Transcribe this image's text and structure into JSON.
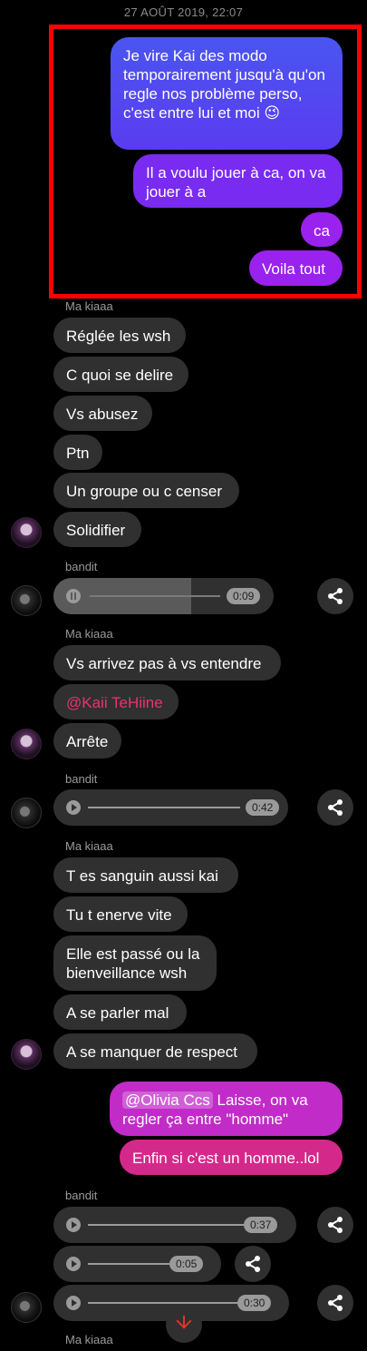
{
  "timestamp": "27 AOÛT 2019, 22:07",
  "sent_block_1": [
    "Je vire Kai des modo temporairement jusqu'à qu'on regle nos problème perso, c'est entre lui et moi 😉",
    "Il a voulu jouer à ca, on va jouer à a",
    "ca",
    "Voila tout"
  ],
  "senders": {
    "kiaaa": "Ma kiaaa",
    "bandit": "bandit"
  },
  "recv_block_1": [
    "Réglée les wsh",
    "C quoi se delire",
    "Vs abusez",
    "Ptn",
    "Un groupe ou c censer",
    "Solidifier"
  ],
  "audio_1": {
    "duration": "0:09",
    "progress_fraction": 0.6
  },
  "recv_block_2": {
    "msg1": "Vs arrivez pas à vs entendre",
    "mention": "@Kaii TeHiine",
    "msg3": "Arrête"
  },
  "audio_2": {
    "duration": "0:42"
  },
  "recv_block_3": [
    "T es sanguin aussi kai",
    "Tu t enerve vite",
    "Elle est passé ou la bienveillance wsh",
    "A se parler mal",
    "A se manquer de respect"
  ],
  "sent_block_2": {
    "mention": "@Olivia Ccs",
    "text": " Laisse, on va regler ça entre \"homme\"",
    "msg2": "Enfin si c'est un homme..lol"
  },
  "audio_3": {
    "duration": "0:37"
  },
  "audio_4": {
    "duration": "0:05"
  },
  "audio_5": {
    "duration": "0:30"
  },
  "icons": {
    "share": "share-icon",
    "scroll": "arrow-down-icon"
  },
  "colors": {
    "highlight": "#ff0000",
    "mention": "#e8336f",
    "scroll_arrow": "#e0342b"
  }
}
